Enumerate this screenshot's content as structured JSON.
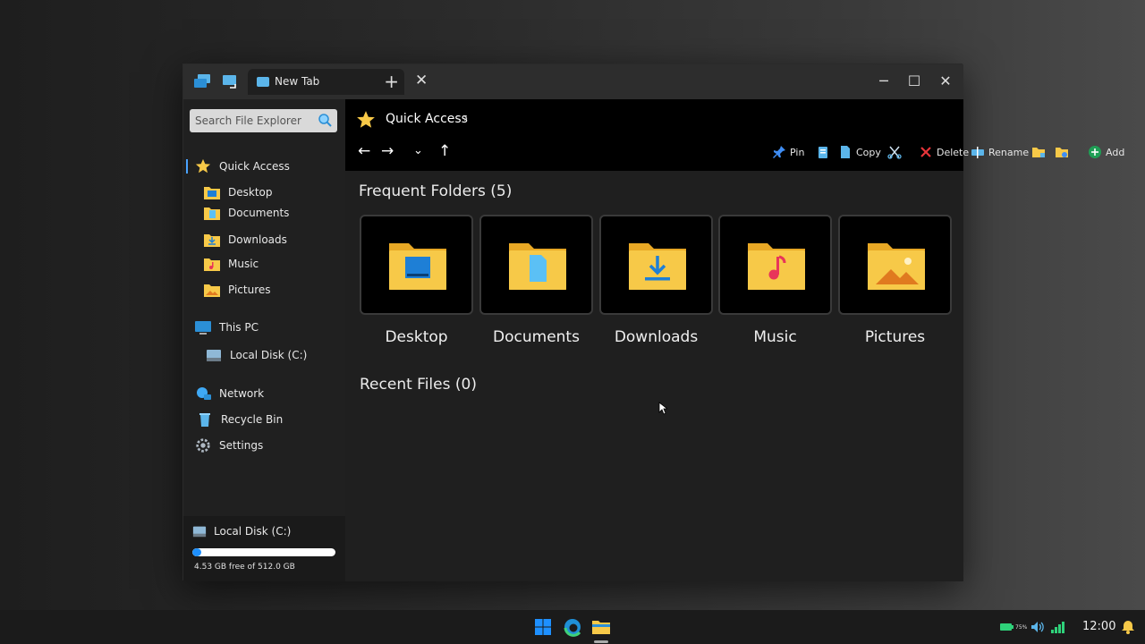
{
  "window": {
    "tab_label": "New Tab",
    "tab_add": "+",
    "tab_close": "✕",
    "minimize": "─",
    "maximize": "☐",
    "close": "✕"
  },
  "sidebar": {
    "search_placeholder": "Search File Explorer",
    "quick_access": "Quick Access",
    "items": [
      {
        "label": "Desktop",
        "icon": "desktop-folder-icon"
      },
      {
        "label": "Documents",
        "icon": "documents-folder-icon"
      },
      {
        "label": "Downloads",
        "icon": "downloads-folder-icon"
      },
      {
        "label": "Music",
        "icon": "music-folder-icon"
      },
      {
        "label": "Pictures",
        "icon": "pictures-folder-icon"
      }
    ],
    "this_pc": "This PC",
    "local_disk": "Local Disk (C:)",
    "network": "Network",
    "recycle_bin": "Recycle Bin",
    "settings": "Settings",
    "disk": {
      "label": "Local Disk (C:)",
      "free_text": "4.53 GB free of 512.0 GB",
      "used_fraction": 0.06
    }
  },
  "topbar": {
    "breadcrumb": "Quick Access",
    "chevron": "›",
    "back": "←",
    "forward": "→",
    "recent": "⌄",
    "up": "↑",
    "actions": {
      "pin": "Pin",
      "copy": "Copy",
      "delete": "Delete",
      "rename": "Rename",
      "add": "Add"
    }
  },
  "content": {
    "frequent_title": "Frequent Folders (5)",
    "folders": [
      {
        "name": "Desktop"
      },
      {
        "name": "Documents"
      },
      {
        "name": "Downloads"
      },
      {
        "name": "Music"
      },
      {
        "name": "Pictures"
      }
    ],
    "recent_title": "Recent Files (0)"
  },
  "taskbar": {
    "clock": "12:00",
    "battery_percent": "75%"
  },
  "colors": {
    "accent": "#1e90ff",
    "folder": "#f7c948",
    "folder_dark": "#e8a825"
  }
}
